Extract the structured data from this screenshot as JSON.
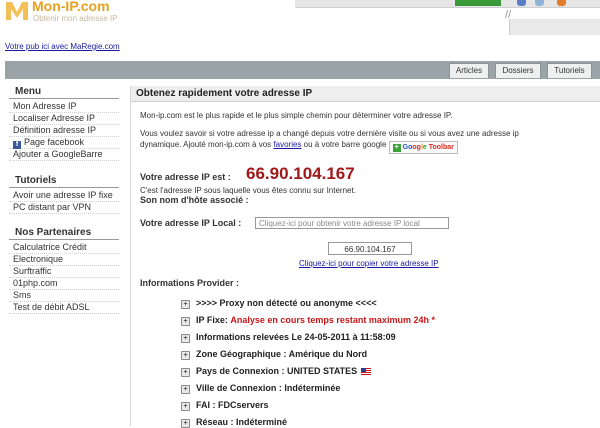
{
  "header": {
    "logo_text": "Mon-IP.com",
    "tagline": "Obtenir mon adresse IP",
    "ad_link": "Votre pub ici avec MaRegie.com"
  },
  "tabs": [
    {
      "label": "Articles"
    },
    {
      "label": "Dossiers"
    },
    {
      "label": "Tutoriels"
    }
  ],
  "sidebar": {
    "menu_title": "Menu",
    "menu_items": [
      {
        "label": "Mon Adresse IP"
      },
      {
        "label": "Localiser Adresse IP"
      },
      {
        "label": "Définition adresse IP"
      },
      {
        "label": "Page facebook"
      },
      {
        "label": "Ajouter a GoogleBarre"
      }
    ],
    "tutorials_title": "Tutoriels",
    "tutorial_items": [
      {
        "label": "Avoir une adresse IP fixe"
      },
      {
        "label": "PC distant par VPN"
      }
    ],
    "partners_title": "Nos Partenaires",
    "partner_items": [
      {
        "label": "Calculatrice Crédit"
      },
      {
        "label": "Electronique"
      },
      {
        "label": "Surftraffic"
      },
      {
        "label": "01php.com"
      },
      {
        "label": "Sms"
      },
      {
        "label": "Test de débit ADSL"
      }
    ]
  },
  "main": {
    "title": "Obtenez rapidement votre adresse IP",
    "intro": "Mon-ip.com est le plus rapide et le plus simple chemin pour déterminer votre adresse IP.",
    "change_text_1": "Vous voulez savoir si votre adresse ip a changé depuis votre dernière visite ou si vous avez une adresse ip",
    "change_text_2": "dynamique. Ajouté mon-ip.com à vos",
    "favorites_link": "favories",
    "change_text_3": "ou à votre barre google",
    "google_toolbar": {
      "g1": "Go",
      "g2": "og",
      "g3": "l",
      "g4": "e",
      "suffix": "Toolbar"
    },
    "ip_label": "Votre adresse IP est :",
    "ip_value": "66.90.104.167",
    "ip_caption": "C'est l'adresse IP sous laquelle vous êtes connu sur Internet.",
    "hostname_label": "Son nom d'hôte associé :",
    "local_ip_label": "Votre adresse IP Local :",
    "local_ip_placeholder": "Cliquez-ici pour obtenir votre adresse IP local",
    "ip_box_value": "66.90.104.167",
    "copy_link": "Cliquez-ici pour copier votre adresse IP",
    "provider_title": "Informations Provider :",
    "info": {
      "proxy": ">>>> Proxy non détecté ou anonyme <<<<",
      "ip_fixe_label": "IP Fixe:",
      "ip_fixe_value": "Analyse en cours temps restant maximum 24h *",
      "relevees": "Informations relevées Le 24-05-2011 à 11:58:09",
      "zone": "Zone Géographique : Amérique du Nord",
      "pays": "Pays de Connexion : UNITED STATES",
      "ville": "Ville de Connexion : Indéterminée",
      "fai": "FAI : FDCservers",
      "reseau": "Réseau : Indéterminé"
    }
  },
  "colors": {
    "ip_red": "#a0181a",
    "tabbar": "#9aa4a6",
    "link": "#1a1aa6"
  }
}
